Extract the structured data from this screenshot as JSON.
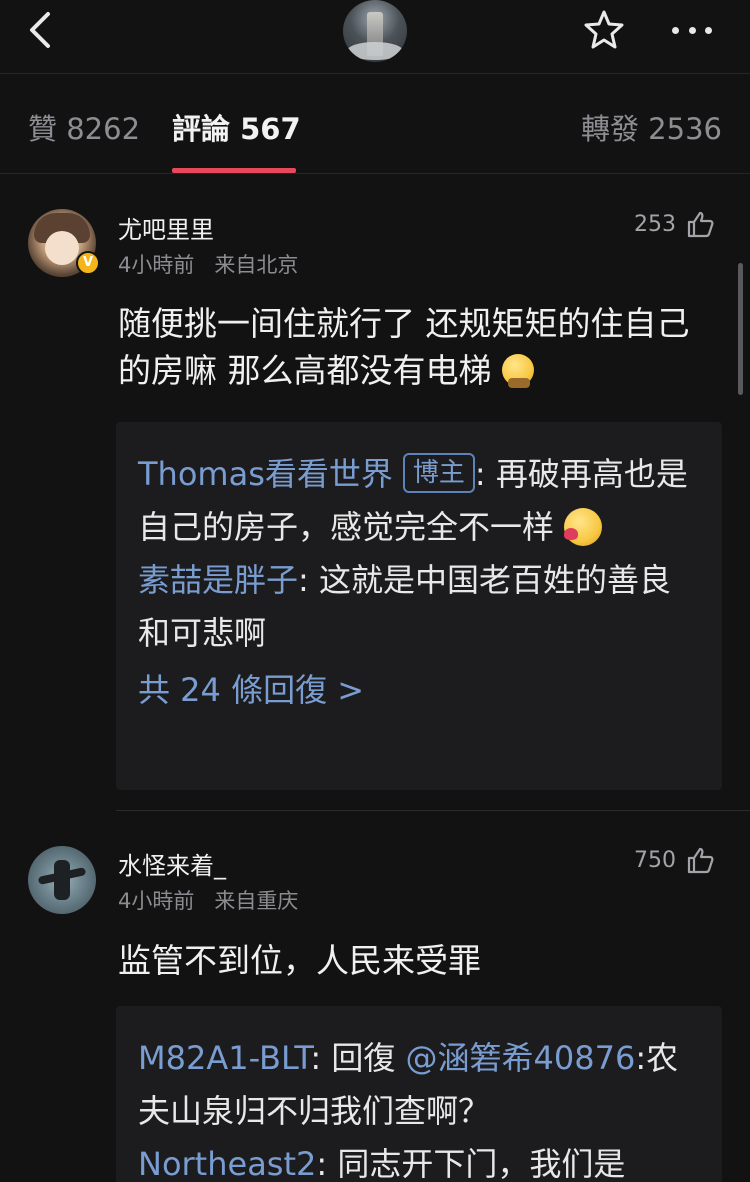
{
  "header": {
    "back_icon": "chevron-left-icon",
    "avatar_alt": "",
    "favorite_icon": "star-icon",
    "more_icon": "more-dots-icon"
  },
  "tabs": [
    {
      "label": "贊 8262",
      "active": false
    },
    {
      "label": "評論 567",
      "active": true
    },
    {
      "label": "轉發 2536",
      "active": false
    }
  ],
  "accent_color": "#e8495a",
  "link_color": "#7a9dd1",
  "comments": [
    {
      "username": "尤吧里里",
      "verified": true,
      "time": "4小時前",
      "location": "来自北京",
      "likes": "253",
      "text": "随便挑一间住就行了 还规矩矩的住自己的房嘛 那么高都没有电梯",
      "replies": [
        {
          "user": "Thomas看看世界",
          "tag": "博主",
          "text": ": 再破再高也是自己的房子，感觉完全不一样"
        },
        {
          "user": "素喆是胖子",
          "text": ": 这就是中国老百姓的善良和可悲啊"
        }
      ],
      "more_replies": "共 24 條回復 >"
    },
    {
      "username": "水怪来着_",
      "verified": false,
      "time": "4小時前",
      "location": "来自重庆",
      "likes": "750",
      "text": "监管不到位，人民来受罪",
      "replies": [
        {
          "user": "M82A1-BLT",
          "text_prefix": ": 回復 ",
          "mention": "@涵箬希40876",
          "text": ":农夫山泉归不归我们查啊？"
        },
        {
          "user": "Northeast2",
          "text": ": 同志开下门，我们是"
        }
      ]
    }
  ]
}
